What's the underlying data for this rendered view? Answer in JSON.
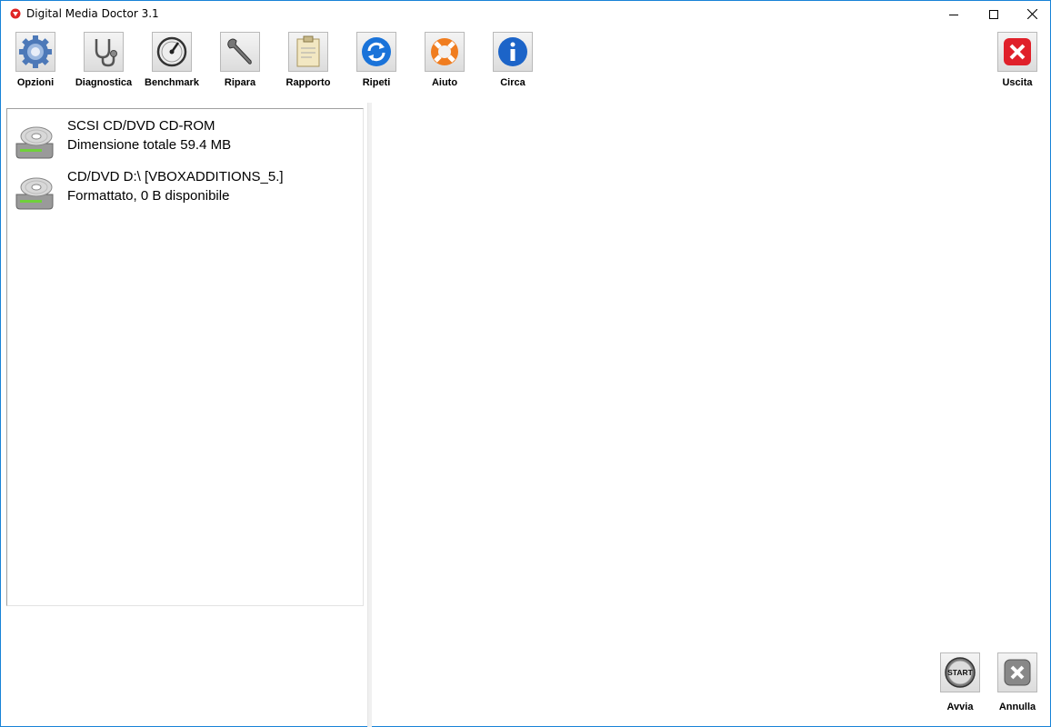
{
  "window": {
    "title": "Digital Media Doctor 3.1"
  },
  "toolbar": {
    "items": [
      {
        "label": "Opzioni",
        "icon": "gear-icon"
      },
      {
        "label": "Diagnostica",
        "icon": "stethoscope-icon"
      },
      {
        "label": "Benchmark",
        "icon": "gauge-icon"
      },
      {
        "label": "Ripara",
        "icon": "wrench-icon"
      },
      {
        "label": "Rapporto",
        "icon": "clipboard-icon"
      },
      {
        "label": "Ripeti",
        "icon": "refresh-icon"
      },
      {
        "label": "Aiuto",
        "icon": "lifebuoy-icon"
      },
      {
        "label": "Circa",
        "icon": "info-icon"
      }
    ],
    "exit_label": "Uscita"
  },
  "drives": [
    {
      "name": "SCSI CD/DVD CD-ROM",
      "info": "Dimensione totale 59.4 MB",
      "icon": "optical-drive-icon"
    },
    {
      "name": "CD/DVD D:\\ [VBOXADDITIONS_5.]",
      "info": "Formattato, 0 B disponibile",
      "icon": "optical-drive-icon"
    }
  ],
  "actions": {
    "start_label": "Avvia",
    "start_icon_text": "START",
    "cancel_label": "Annulla"
  },
  "colors": {
    "window_border": "#1883d7",
    "exit_red": "#e0202a",
    "refresh_blue": "#1a73d9",
    "info_blue": "#1c64c8",
    "lifebuoy_orange": "#f07d20"
  }
}
